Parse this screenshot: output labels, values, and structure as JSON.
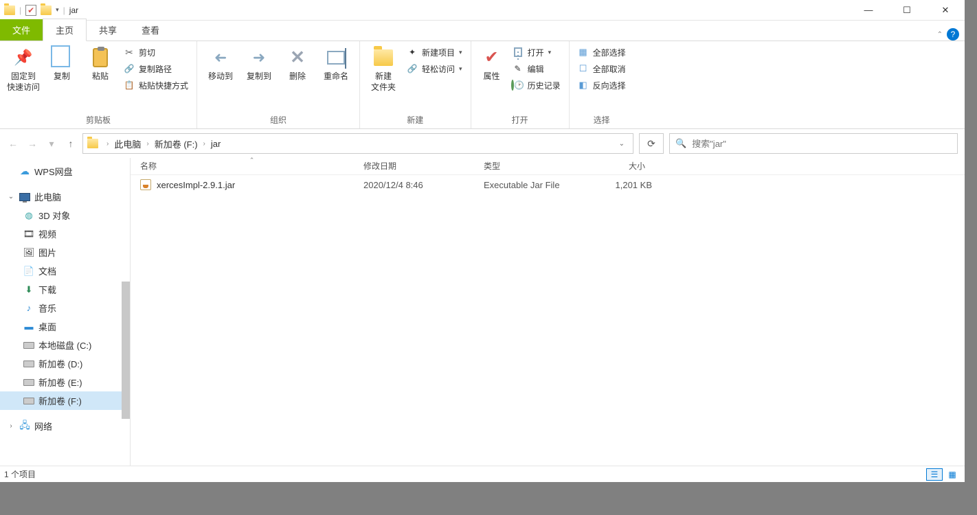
{
  "title": "jar",
  "tabs": {
    "file": "文件",
    "home": "主页",
    "share": "共享",
    "view": "查看"
  },
  "ribbon": {
    "clipboard": {
      "label": "剪贴板",
      "pin": "固定到\n快速访问",
      "copy": "复制",
      "paste": "粘贴",
      "cut": "剪切",
      "copypath": "复制路径",
      "pasteshortcut": "粘贴快捷方式"
    },
    "organize": {
      "label": "组织",
      "moveto": "移动到",
      "copyto": "复制到",
      "delete": "删除",
      "rename": "重命名"
    },
    "new": {
      "label": "新建",
      "newfolder": "新建\n文件夹",
      "newitem": "新建项目",
      "easyaccess": "轻松访问"
    },
    "open": {
      "label": "打开",
      "properties": "属性",
      "open": "打开",
      "edit": "编辑",
      "history": "历史记录"
    },
    "select": {
      "label": "选择",
      "selectall": "全部选择",
      "selectnone": "全部取消",
      "invert": "反向选择"
    }
  },
  "breadcrumb": {
    "thispc": "此电脑",
    "drive": "新加卷 (F:)",
    "folder": "jar"
  },
  "search": {
    "placeholder": "搜索\"jar\""
  },
  "nav": {
    "wps": "WPS网盘",
    "thispc": "此电脑",
    "items": [
      {
        "label": "3D 对象"
      },
      {
        "label": "视频"
      },
      {
        "label": "图片"
      },
      {
        "label": "文档"
      },
      {
        "label": "下载"
      },
      {
        "label": "音乐"
      },
      {
        "label": "桌面"
      },
      {
        "label": "本地磁盘 (C:)"
      },
      {
        "label": "新加卷 (D:)"
      },
      {
        "label": "新加卷 (E:)"
      },
      {
        "label": "新加卷 (F:)"
      }
    ],
    "network": "网络"
  },
  "columns": {
    "name": "名称",
    "date": "修改日期",
    "type": "类型",
    "size": "大小"
  },
  "files": [
    {
      "name": "xercesImpl-2.9.1.jar",
      "date": "2020/12/4 8:46",
      "type": "Executable Jar File",
      "size": "1,201 KB"
    }
  ],
  "status": "1 个项目"
}
